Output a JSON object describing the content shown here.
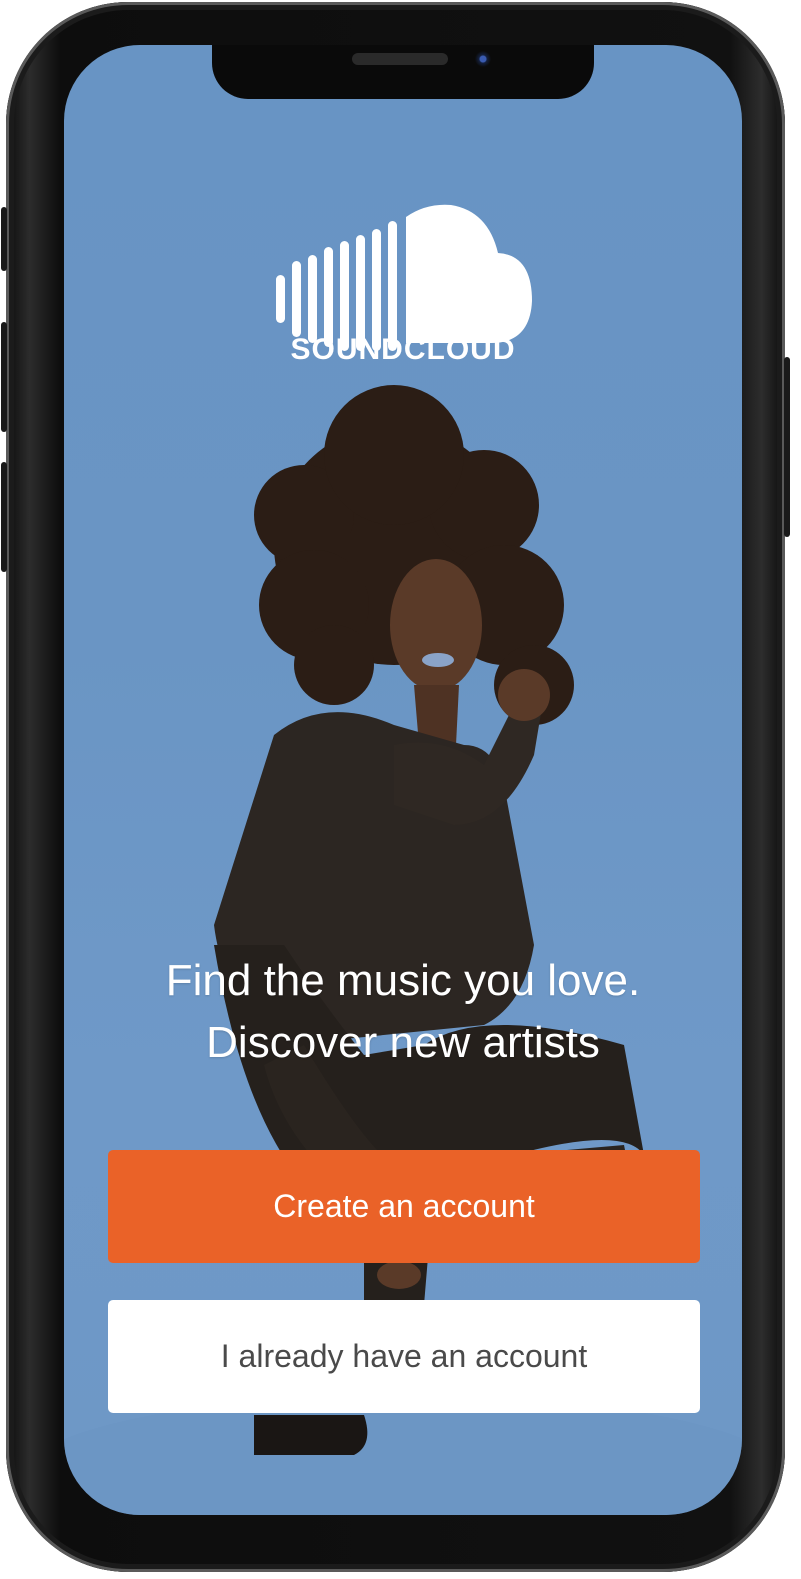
{
  "app": {
    "brand_name": "SOUNDCLOUD",
    "logo_icon": "soundcloud-cloud-icon"
  },
  "hero": {
    "line1": "Find the music you love.",
    "line2": "Discover new artists"
  },
  "actions": {
    "create_label": "Create an account",
    "login_label": "I already have an account"
  },
  "colors": {
    "background": "#6a95c4",
    "primary_button": "#ea6228",
    "secondary_button": "#ffffff",
    "text_light": "#ffffff"
  }
}
